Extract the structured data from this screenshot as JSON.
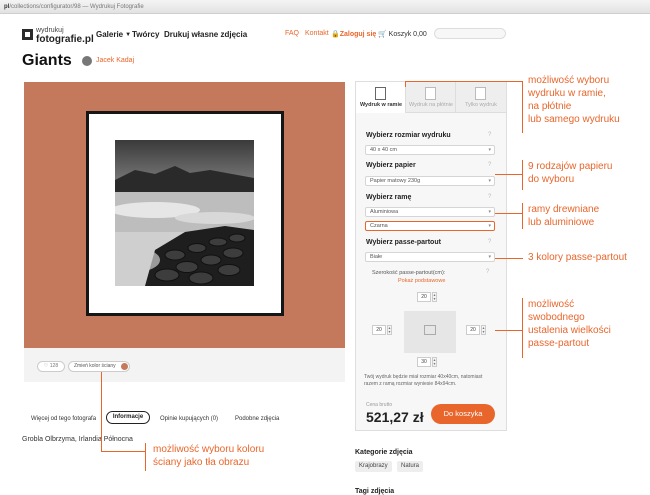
{
  "browser": {
    "url_domain": "pl",
    "url_rest": "/collections/configurator/98 — Wydrukuj Fotografie"
  },
  "header": {
    "logo_top": "wydrukuj",
    "logo_bottom": "fotografie.pl",
    "nav": [
      "Galerie",
      "Twórcy",
      "Drukuj własne zdjęcia"
    ],
    "faq": "FAQ",
    "contact": "Kontakt",
    "login": "Zaloguj się",
    "cart": "Koszyk  0,00"
  },
  "photo": {
    "title": "Giants",
    "author": "Jacek Kadaj",
    "likes": "128",
    "wall_color_button": "Zmień kolor ściany",
    "wall_color": "#c4785c",
    "location": "Grobla Olbrzyma, Irlandia Północna"
  },
  "info_tabs": [
    "Więcej od tego fotografa",
    "Informacje",
    "Opinie kupujących (0)",
    "Podobne zdjęcia"
  ],
  "config": {
    "tabs": [
      "Wydruk w ramie",
      "Wydruk na płótnie",
      "Tylko wydruk"
    ],
    "size_label": "Wybierz rozmiar wydruku",
    "size_value": "40 x 40 cm",
    "paper_label": "Wybierz papier",
    "paper_value": "Papier matowy 230g",
    "frame_label": "Wybierz ramę",
    "frame_material": "Aluminiowa",
    "frame_color": "Czarna",
    "pp_label": "Wybierz passe-partout",
    "pp_value": "Białe",
    "pp_width_label": "Szerokość passe-partout(cm):",
    "pp_advanced": "Pokaż podstawowe",
    "pp_top": "20",
    "pp_left": "20",
    "pp_right": "20",
    "pp_bottom": "30",
    "dims_note": "Twój wydruk będzie miał rozmiar 40x40cm, natomiast razem z ramą rozmiar wyniesie 84x94cm.",
    "price_label": "Cena brutto",
    "price": "521,27 zł",
    "buy_button": "Do koszyka"
  },
  "categories": {
    "title": "Kategorie zdjęcia",
    "items": [
      "Krajobrazy",
      "Natura"
    ]
  },
  "tags_title": "Tagi zdjęcia",
  "annotations": {
    "frame_options": [
      "możliwość wyboru",
      "wydruku w ramie,",
      "na płótnie",
      "lub samego wydruku"
    ],
    "paper_types": [
      "9 rodzajów papieru",
      "do wyboru"
    ],
    "frames": [
      "ramy drewniane",
      "lub aluminiowe"
    ],
    "pp_colors": [
      "3 kolory passe-partout"
    ],
    "pp_size": [
      "możliwość",
      "swobodnego",
      "ustalenia wielkości",
      "passe-partout"
    ],
    "wall_color": [
      "możliwość wyboru koloru",
      "ściany jako tła obrazu"
    ]
  },
  "colors": {
    "accent": "#e8662c",
    "wall": "#c4785c"
  }
}
